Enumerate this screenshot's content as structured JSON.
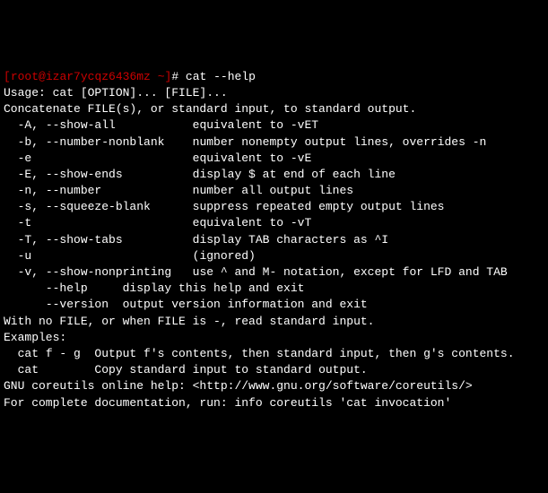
{
  "prompt": {
    "open": "[",
    "user": "root",
    "at": "@",
    "host": "izar7ycqz6436mz",
    "space": " ",
    "tilde": "~",
    "close": "]",
    "hash": "#",
    "command": " cat --help"
  },
  "output": {
    "l1": "Usage: cat [OPTION]... [FILE]...",
    "l2": "Concatenate FILE(s), or standard input, to standard output.",
    "l3": "",
    "l4": "  -A, --show-all           equivalent to -vET",
    "l5": "  -b, --number-nonblank    number nonempty output lines, overrides -n",
    "l6": "  -e                       equivalent to -vE",
    "l7": "  -E, --show-ends          display $ at end of each line",
    "l8": "  -n, --number             number all output lines",
    "l9": "  -s, --squeeze-blank      suppress repeated empty output lines",
    "l10": "  -t                       equivalent to -vT",
    "l11": "  -T, --show-tabs          display TAB characters as ^I",
    "l12": "  -u                       (ignored)",
    "l13": "  -v, --show-nonprinting   use ^ and M- notation, except for LFD and TAB",
    "l14": "      --help     display this help and exit",
    "l15": "      --version  output version information and exit",
    "l16": "",
    "l17": "With no FILE, or when FILE is -, read standard input.",
    "l18": "",
    "l19": "Examples:",
    "l20": "  cat f - g  Output f's contents, then standard input, then g's contents.",
    "l21": "  cat        Copy standard input to standard output.",
    "l22": "",
    "l23": "GNU coreutils online help: <http://www.gnu.org/software/coreutils/>",
    "l24": "For complete documentation, run: info coreutils 'cat invocation'"
  }
}
